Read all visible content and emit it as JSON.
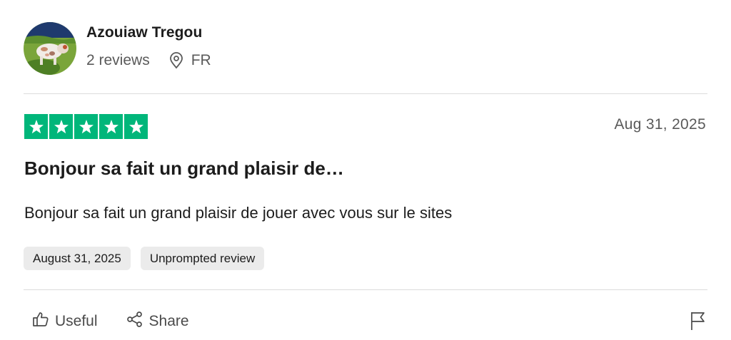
{
  "reviewer": {
    "name": "Azouiaw Tregou",
    "review_count": "2 reviews",
    "country": "FR",
    "avatar_icon": "avatar-dog-photo"
  },
  "review": {
    "rating": 5,
    "star_color": "#00b67a",
    "date": "Aug 31, 2025",
    "title": "Bonjour sa fait un grand plaisir de…",
    "body": "Bonjour sa fait un grand plaisir de jouer avec vous sur le sites",
    "tags": [
      "August 31, 2025",
      "Unprompted review"
    ]
  },
  "actions": {
    "useful_label": "Useful",
    "share_label": "Share",
    "useful_icon": "thumbs-up-icon",
    "share_icon": "share-icon",
    "report_icon": "flag-icon"
  }
}
